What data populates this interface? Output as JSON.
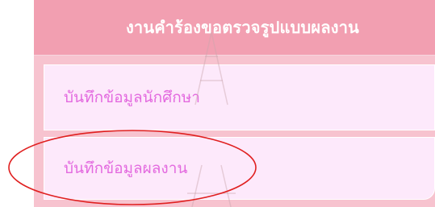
{
  "panel": {
    "title": "งานคำร้องขอตรวจรูปแบบผลงาน"
  },
  "menu": {
    "items": [
      {
        "label": "บันทึกข้อมูลนักศึกษา"
      },
      {
        "label": "บันทึกข้อมูลผลงาน"
      }
    ]
  },
  "colors": {
    "header_bg": "#f29fb1",
    "panel_bg": "#f7c3cf",
    "item_bg": "#fde9fb",
    "item_text": "#e36adf",
    "annotation": "#e02020"
  }
}
